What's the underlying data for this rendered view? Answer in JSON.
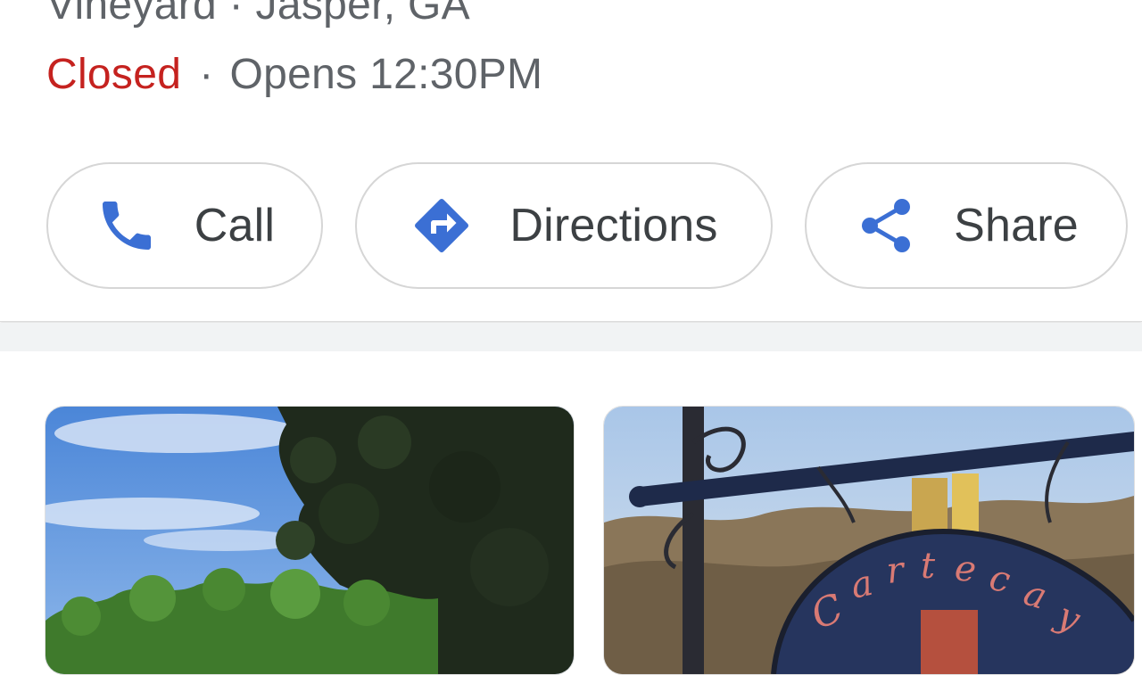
{
  "place": {
    "subtitle": "Vineyard · Jasper, GA",
    "status": "Closed",
    "separator": "·",
    "hours": "Opens 12:30PM"
  },
  "actions": {
    "call_label": "Call",
    "directions_label": "Directions",
    "share_label": "Share"
  },
  "icons": {
    "call": "phone-icon",
    "directions": "directions-icon",
    "share": "share-icon"
  },
  "colors": {
    "accent": "#3b6fd4",
    "closed": "#c5221f",
    "muted_text": "#5f6368",
    "button_text": "#3c4043"
  },
  "photos": {
    "sign_text": "Cartecay"
  }
}
